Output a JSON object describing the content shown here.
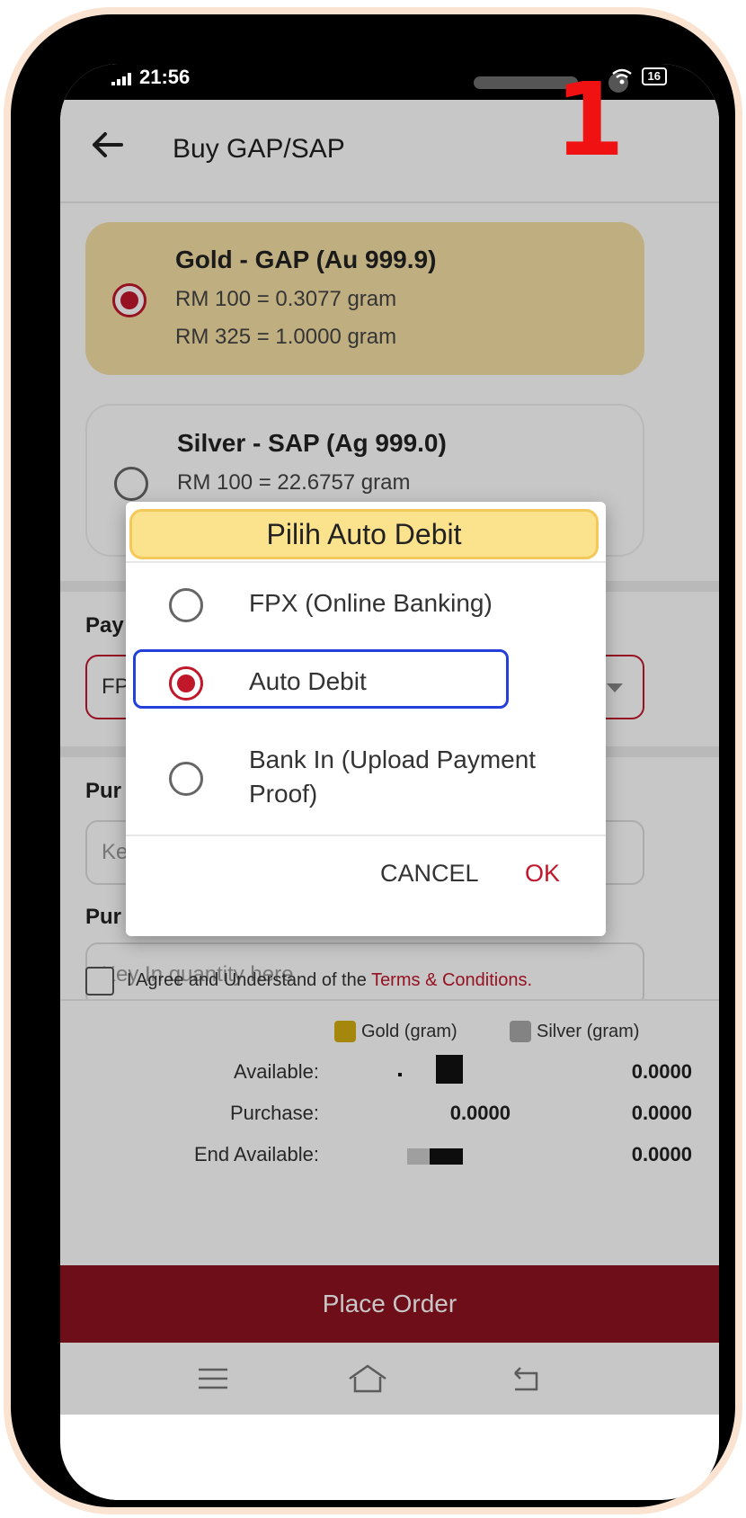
{
  "status": {
    "time": "21:56",
    "battery": "16"
  },
  "header": {
    "title": "Buy GAP/SAP",
    "step_number": "1"
  },
  "products": [
    {
      "name": "Gold - GAP (Au 999.9)",
      "line1": "RM 100 = 0.3077 gram",
      "line2": "RM 325 = 1.0000 gram",
      "selected": true
    },
    {
      "name": "Silver - SAP (Ag 999.0)",
      "line1": "RM 100 = 22.6757 gram",
      "selected": false
    }
  ],
  "form": {
    "payment_label": "Pay",
    "payment_value": "FP",
    "purchase_amount_label": "Pur",
    "purchase_amount_placeholder": "Ke",
    "purchase_quantity_label": "Pur",
    "purchase_quantity_placeholder": "Key In quantity here"
  },
  "agreement": {
    "text": "I Agree and Understand of the ",
    "link": "Terms & Conditions."
  },
  "summary": {
    "legend_gold": "Gold (gram)",
    "legend_silver": "Silver (gram)",
    "rows": [
      {
        "label": "Available:",
        "gold": "",
        "silver": "0.0000"
      },
      {
        "label": "Purchase:",
        "gold": "0.0000",
        "silver": "0.0000"
      },
      {
        "label": "End Available:",
        "gold": "",
        "silver": "0.0000"
      }
    ]
  },
  "place_order_label": "Place Order",
  "dialog": {
    "title": "Pilih Auto Debit",
    "options": [
      {
        "label": "FPX (Online Banking)",
        "selected": false
      },
      {
        "label": "Auto Debit",
        "selected": true
      },
      {
        "label": "Bank In (Upload Payment Proof)",
        "selected": false
      }
    ],
    "cancel_label": "CANCEL",
    "ok_label": "OK"
  },
  "colors": {
    "brand_red": "#c0172b",
    "place_order_bg": "#8d1320",
    "gold_card": "#f5dfa3",
    "highlight_blue": "#2440d8",
    "annotation_red": "#f01212"
  },
  "icons": [
    "back-arrow-icon",
    "signal-icon",
    "wifi-icon",
    "menu-icon",
    "home-icon",
    "back-nav-icon"
  ]
}
